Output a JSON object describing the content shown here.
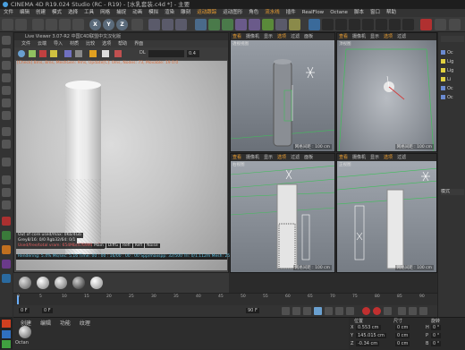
{
  "window": {
    "title": "CINEMA 4D R19.024 Studio (RC - R19) - [水乳套装.c4d *] - 主要"
  },
  "menubar": [
    "文件",
    "编辑",
    "创建",
    "模式",
    "选择",
    "工具",
    "网格",
    "捕捉",
    "动画",
    "模拟",
    "渲染",
    "雕刻",
    "运动跟踪",
    "运动图形",
    "角色",
    "流水线",
    "插件",
    "RealFlow",
    "Octane",
    "脚本",
    "窗口",
    "帮助"
  ],
  "menubar_highlight": [
    "运动跟踪",
    "流水线"
  ],
  "toolbar": {
    "axis_x": "X",
    "axis_y": "Y",
    "axis_z": "Z"
  },
  "live_viewer": {
    "title": "Live Viewer 3.07-R2 中国C4D联盟中文汉化版",
    "menu": [
      "文件",
      "云端",
      "导入",
      "材质",
      "比较",
      "选项",
      "帮助",
      "界面"
    ],
    "status_line": "[Check] 8ms, 8ms, MeshGen: 9ms, Update[C]: 0ms, Nodes: 73, Movable: 19  0:0",
    "zoom_label": "DL",
    "zoom_value": "0.4",
    "info_lines": [
      "Out of core used/max: 0Kb/4Gb",
      "Grey8/16: 0/0       Rgb32/64: 0/1",
      "Used/free/total vram: 654Mb/4769Mb/6Gb",
      "Rendering: 5.4%     Ms/sec: 5.16    Time: 00 : 00 : 16/00 : 00 : 00    Spp/maxspp: 32/500    Tri: 0/1.112m    Mesh: 25    Hair: 0"
    ],
    "mode_buttons": [
      "Main",
      "DiffG",
      "Refl",
      "Refl",
      "Noise"
    ]
  },
  "viewports": [
    {
      "name": "透视视图",
      "menu": [
        "查看",
        "摄像机",
        "显示",
        "选项",
        "过滤",
        "面板"
      ],
      "footer": "网格间距 : 100 cm"
    },
    {
      "name": "顶视图",
      "menu": [
        "查看",
        "摄像机",
        "显示",
        "选项",
        "过滤",
        "面板"
      ],
      "footer": "网格间距 : 100 cm"
    },
    {
      "name": "右视图",
      "menu": [
        "查看",
        "摄像机",
        "显示",
        "选项",
        "过滤",
        "面板"
      ],
      "footer": "网格间距 : 100 cm"
    },
    {
      "name": "正视图",
      "menu": [
        "查看",
        "摄像机",
        "显示",
        "选项",
        "过滤",
        "面板"
      ],
      "footer": "网格间距 : 100 cm"
    }
  ],
  "object_manager": {
    "items": [
      "Oc",
      "Lig",
      "Lig",
      "Li",
      "Oc",
      "Oc"
    ],
    "attrs_tab": "模式"
  },
  "timeline": {
    "ticks": [
      "0",
      "5",
      "10",
      "15",
      "20",
      "25",
      "30",
      "35",
      "40",
      "45",
      "50",
      "55",
      "60",
      "65",
      "70",
      "75",
      "80",
      "85",
      "90"
    ],
    "frame_start": "0 F",
    "frame_current": "0 F",
    "frame_end": "90 F"
  },
  "material_manager": {
    "menu": [
      "创建",
      "编辑",
      "功能",
      "纹理"
    ],
    "material_name": "Octan"
  },
  "coordinates": {
    "headers": [
      "位置",
      "尺寸",
      "旋转"
    ],
    "rows": [
      {
        "axis": "X",
        "pos": "0.553 cm",
        "size": "0 cm",
        "rot_label": "H",
        "rot": "0 °"
      },
      {
        "axis": "Y",
        "pos": "145.015 cm",
        "size": "0 cm",
        "rot_label": "P",
        "rot": "0 °"
      },
      {
        "axis": "Z",
        "pos": "-0.34 cm",
        "size": "0 cm",
        "rot_label": "B",
        "rot": "0 °"
      }
    ]
  },
  "colors": {
    "accent": "#f0a030",
    "grid_green": "#3fbf5a",
    "axis_red": "#d04040"
  }
}
